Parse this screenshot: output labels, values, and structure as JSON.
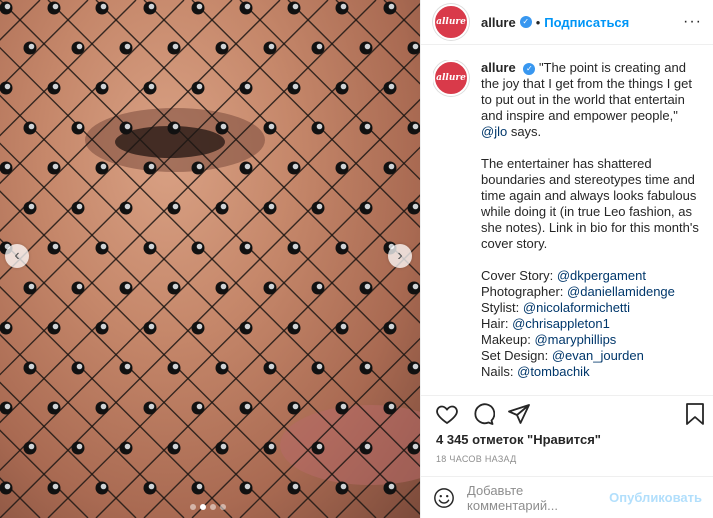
{
  "post": {
    "account": "allure",
    "avatar_text": "allure",
    "verified_icon": "verified-badge-icon",
    "separator": "•",
    "follow_label": "Подписаться",
    "more_icon": "more-options-icon",
    "more_label": "···",
    "photo_nav_prev": "‹",
    "photo_nav_next": "›",
    "caption": {
      "author": "allure",
      "p1_text": "\"The point is creating and the joy that I get from the things I get to put out in the world that entertain and inspire and empower people,\" ",
      "p1_mention": "@jlo",
      "p1_end": " says.",
      "p2": "The entertainer has shattered boundaries and stereotypes time and time again and always looks fabulous while doing it (in true Leo fashion, as she notes). Link in bio for this month's cover story.",
      "credits": [
        {
          "role": "Cover Story: ",
          "handle": "@dkpergament"
        },
        {
          "role": "Photographer: ",
          "handle": "@daniellamidenge"
        },
        {
          "role": "Stylist: ",
          "handle": "@nicolaformichetti"
        },
        {
          "role": "Hair: ",
          "handle": "@chrisappleton1"
        },
        {
          "role": "Makeup: ",
          "handle": "@maryphillips"
        },
        {
          "role": "Set Design: ",
          "handle": "@evan_jourden"
        },
        {
          "role": "Nails: ",
          "handle": "@tombachik"
        }
      ]
    },
    "likes": "4 345 отметок \"Нравится\"",
    "timestamp": "18 ЧАСОВ НАЗАД",
    "comment_placeholder": "Добавьте комментарий...",
    "post_button": "Опубликовать",
    "icons": [
      "heart-icon",
      "comment-icon",
      "share-icon",
      "bookmark-icon",
      "emoji-icon"
    ],
    "colors": {
      "accent": "#0095f6",
      "verified": "#3897f0",
      "brand": "#d93a4a"
    }
  }
}
